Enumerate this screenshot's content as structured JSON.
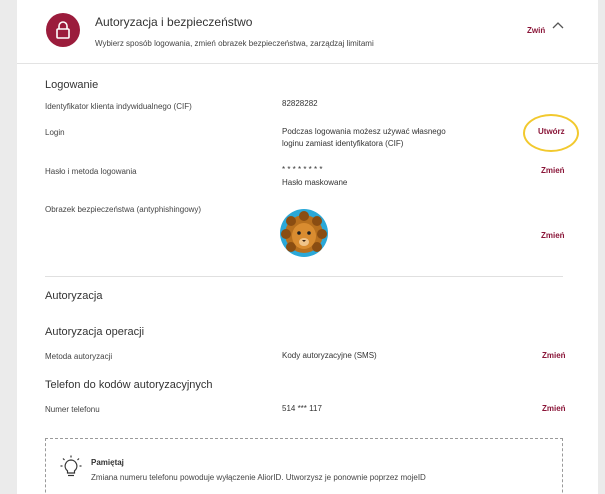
{
  "header": {
    "title": "Autoryzacja i bezpieczeństwo",
    "subtitle": "Wybierz sposób logowania, zmień obrazek bezpieczeństwa, zarządzaj limitami",
    "collapse_label": "Zwiń",
    "icon": "lock-icon",
    "accent": "#9b1c3c"
  },
  "login_section": {
    "title": "Logowanie",
    "rows": [
      {
        "label": "Identyfikator klienta indywidualnego (CIF)",
        "value": "82828282"
      },
      {
        "label": "Login",
        "value_line1": "Podczas logowania możesz używać własnego",
        "value_line2": "loginu zamiast identyfikatora (CIF)",
        "action": "Utwórz"
      },
      {
        "label": "Hasło i metoda logowania",
        "value_line1": "* * * * * * * *",
        "value_line2": "Hasło maskowane",
        "action": "Zmień"
      },
      {
        "label": "Obrazek bezpieczeństwa (antyphishingowy)",
        "action": "Zmień"
      }
    ]
  },
  "auth_section": {
    "title": "Autoryzacja",
    "operations": {
      "title": "Autoryzacja operacji",
      "label": "Metoda autoryzacji",
      "value": "Kody autoryzacyjne (SMS)",
      "action": "Zmień"
    },
    "phone": {
      "title": "Telefon do kodów autoryzacyjnych",
      "label": "Numer telefonu",
      "value": "514 *** 117",
      "action": "Zmień"
    }
  },
  "notice": {
    "icon": "lightbulb-icon",
    "title": "Pamiętaj",
    "text": "Zmiana numeru telefonu powoduje wyłączenie AliorID. Utworzysz je ponownie poprzez mojeID"
  },
  "colors": {
    "action": "#8a1538",
    "highlight_ring": "#f2c92e"
  }
}
